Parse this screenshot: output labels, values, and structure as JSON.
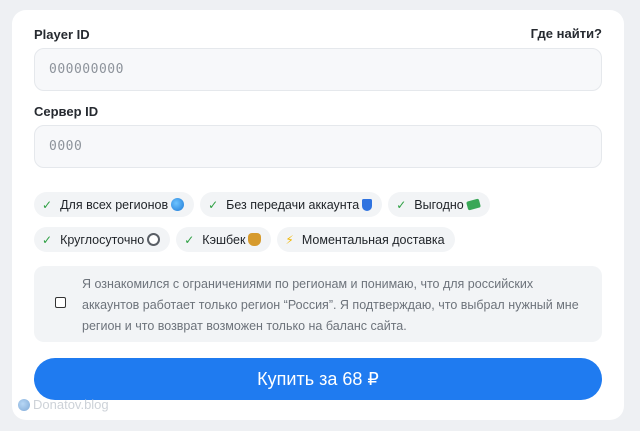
{
  "form": {
    "player_id_label": "Player ID",
    "player_id_placeholder": "000000000",
    "help_link": "Где найти?",
    "server_id_label": "Сервер ID",
    "server_id_placeholder": "0000"
  },
  "features": [
    {
      "label": "Для всех регионов",
      "icon": "globe-icon"
    },
    {
      "label": "Без передачи аккаунта",
      "icon": "shield-icon"
    },
    {
      "label": "Выгодно",
      "icon": "money-icon"
    },
    {
      "label": "Круглосуточно",
      "icon": "clock-icon"
    },
    {
      "label": "Кэшбек",
      "icon": "money-bag-icon"
    },
    {
      "label": "Моментальная доставка",
      "icon": "lightning-icon"
    }
  ],
  "consent": {
    "checked": false,
    "text": "Я ознакомился с ограничениями по регионам и понимаю, что для российских аккаунтов работает только регион “Россия”. Я подтверждаю, что выбрал нужный мне регион и что возврат возможен только на баланс сайта."
  },
  "buy_button": {
    "label": "Купить за 68 ₽"
  },
  "watermark": {
    "text": "Donatov.blog"
  },
  "colors": {
    "accent": "#1f7bf0",
    "check": "#2ea043",
    "background": "#eef0f3"
  }
}
